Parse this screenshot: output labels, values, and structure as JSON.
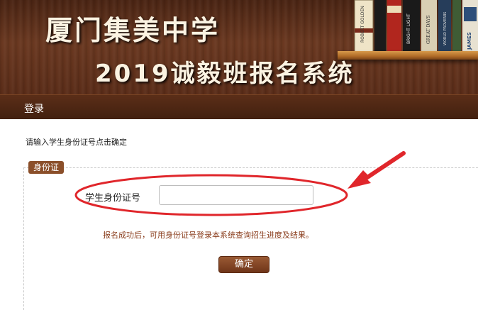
{
  "header": {
    "title_line1": "厦门集美中学",
    "title_line2": "2019诚毅班报名系统",
    "book_spines": [
      "ROBERT GOLDEN",
      "BRIGHT LIGHT",
      "GREAT DAYS",
      "WORLD PROVERBS",
      "JAMES"
    ]
  },
  "nav": {
    "login": "登录"
  },
  "main": {
    "instruction": "请输入学生身份证号点击确定",
    "section_legend": "身份证",
    "id_field": {
      "label": "学生身份证号",
      "value": "",
      "placeholder": ""
    },
    "notice": "报名成功后，可用身份证号登录本系统查询招生进度及结果。",
    "confirm_button": "确定"
  },
  "annotation": {
    "color": "#e0262b"
  },
  "colors": {
    "header_bg": "#5a2c18",
    "nav_bg": "#4a2412",
    "legend_bg": "#8b4f2a",
    "button_bg": "#7f4323",
    "notice_text": "#8a3d1c"
  }
}
